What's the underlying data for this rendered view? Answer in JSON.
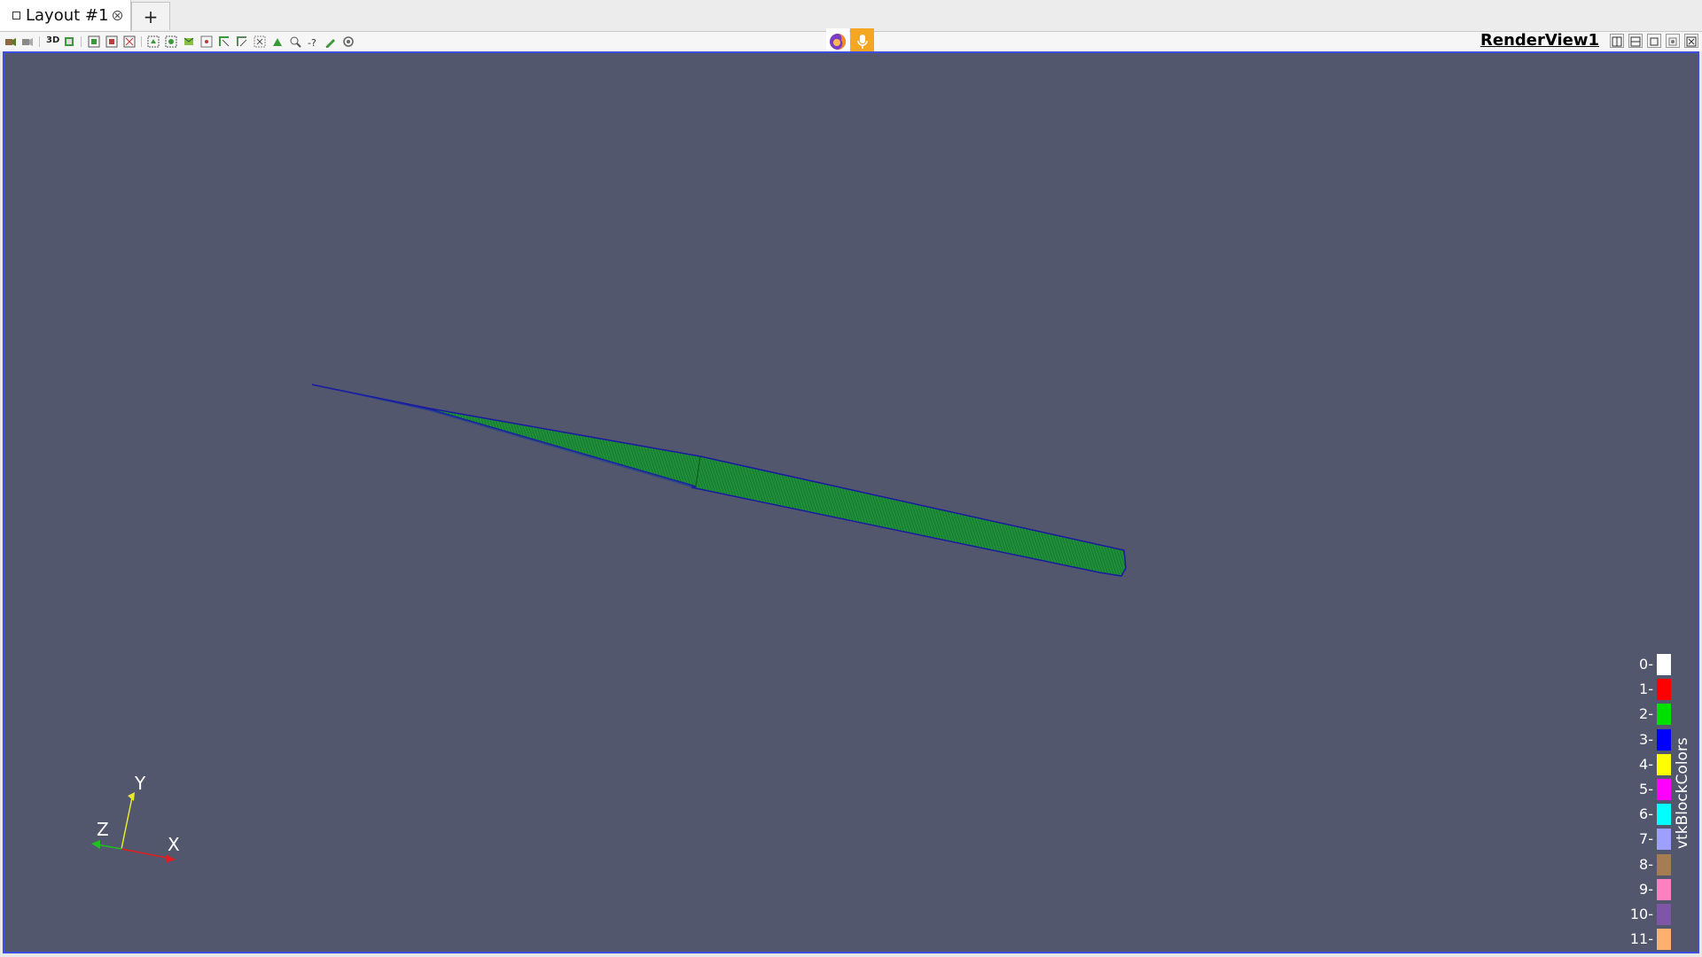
{
  "tabs": {
    "active_label": "Layout #1",
    "add_label": "+"
  },
  "toolbar": {
    "mode_3d_label": "3D"
  },
  "view": {
    "title": "RenderView1",
    "background": "#52576e",
    "border_color": "#3a4fe0"
  },
  "legend": {
    "title": "vtkBlockColors",
    "entries": [
      {
        "label": "0",
        "color": "#ffffff"
      },
      {
        "label": "1",
        "color": "#ff0000"
      },
      {
        "label": "2",
        "color": "#00e000"
      },
      {
        "label": "3",
        "color": "#0000ff"
      },
      {
        "label": "4",
        "color": "#ffff00"
      },
      {
        "label": "5",
        "color": "#ff00ff"
      },
      {
        "label": "6",
        "color": "#00ffff"
      },
      {
        "label": "7",
        "color": "#9ea0ff"
      },
      {
        "label": "8",
        "color": "#a67c52"
      },
      {
        "label": "9",
        "color": "#ff80c0"
      },
      {
        "label": "10",
        "color": "#7f55a8"
      },
      {
        "label": "11",
        "color": "#ffb070"
      }
    ]
  },
  "axes": {
    "x": "X",
    "y": "Y",
    "z": "Z"
  },
  "icons": {
    "browser": "firefox-icon",
    "microphone": "microphone-icon"
  }
}
